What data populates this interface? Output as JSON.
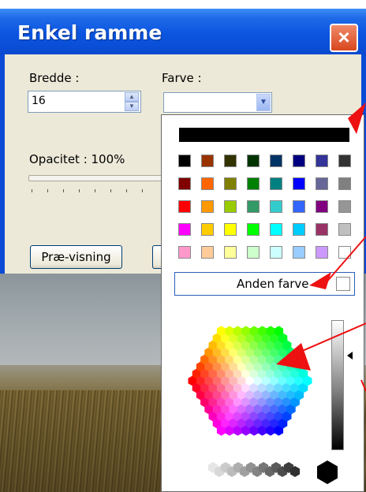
{
  "dialog": {
    "title": "Enkel ramme",
    "close_icon": "×",
    "width_label": "Bredde :",
    "width_value": "16",
    "color_label": "Farve :",
    "opacity_label": "Opacitet : 100%",
    "preview_button": "Præ-visning"
  },
  "picker": {
    "other_color_label": "Anden farve",
    "swatch_rows": [
      [
        "#000000",
        "#993300",
        "#333300",
        "#003300",
        "#003366",
        "#000080",
        "#333399",
        "#333333"
      ],
      [
        "#800000",
        "#ff6600",
        "#808000",
        "#008000",
        "#008080",
        "#0000ff",
        "#666699",
        "#808080"
      ],
      [
        "#ff0000",
        "#ff9900",
        "#99cc00",
        "#339966",
        "#33cccc",
        "#3366ff",
        "#800080",
        "#969696"
      ],
      [
        "#ff00ff",
        "#ffcc00",
        "#ffff00",
        "#00ff00",
        "#00ffff",
        "#00ccff",
        "#993366",
        "#c0c0c0"
      ],
      [
        "#ff99cc",
        "#ffcc99",
        "#ffff99",
        "#ccffcc",
        "#ccffff",
        "#99ccff",
        "#cc99ff",
        "#ffffff"
      ]
    ]
  },
  "colors": {
    "titlebar": "#0a55e0",
    "accent_arrow": "#ee1111"
  }
}
